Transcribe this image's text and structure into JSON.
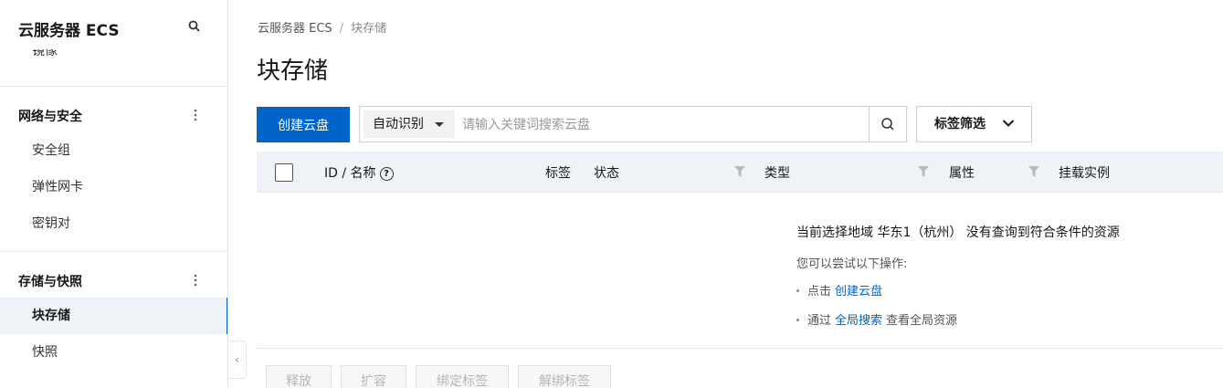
{
  "sidebar": {
    "title": "云服务器 ECS",
    "cut_item": "镜像",
    "groups": [
      {
        "label": "网络与安全",
        "items": [
          "安全组",
          "弹性网卡",
          "密钥对"
        ]
      },
      {
        "label": "存储与快照",
        "items": [
          "块存储",
          "快照"
        ]
      }
    ],
    "active_item": "块存储"
  },
  "breadcrumb": {
    "root": "云服务器 ECS",
    "separator": "/",
    "current": "块存储"
  },
  "page_title": "块存储",
  "toolbar": {
    "create_label": "创建云盘",
    "search_type": "自动识别",
    "search_placeholder": "请输入关键词搜索云盘",
    "tag_filter_label": "标签筛选"
  },
  "table": {
    "columns": {
      "id_name": "ID / 名称",
      "tags": "标签",
      "status": "状态",
      "type": "类型",
      "attribute": "属性",
      "instance": "挂载实例"
    }
  },
  "empty": {
    "title": "当前选择地域 华东1（杭州） 没有查询到符合条件的资源",
    "subtitle": "您可以尝试以下操作:",
    "line1_prefix": "点击",
    "line1_link": "创建云盘",
    "line2_prefix": "通过",
    "line2_link": "全局搜索",
    "line2_suffix": "查看全局资源"
  },
  "footer_buttons": [
    "释放",
    "扩容",
    "绑定标签",
    "解绑标签"
  ],
  "colors": {
    "primary": "#0064c8",
    "header_bg": "#eff3f8"
  }
}
